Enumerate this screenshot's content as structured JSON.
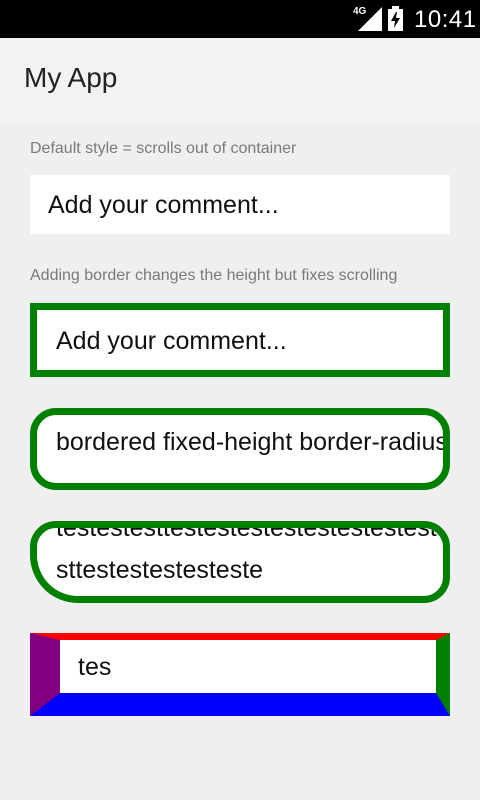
{
  "status_bar": {
    "network": "4G",
    "time": "10:41",
    "signal_icon": "signal-strength-icon",
    "battery_icon": "battery-charging-icon"
  },
  "app_bar": {
    "title": "My App"
  },
  "main": {
    "caption_default": "Default style = scrolls out of container",
    "input_default": "Add your comment...",
    "caption_border": "Adding border changes the height but fixes scrolling",
    "input_bordered": "Add your comment...",
    "input_rounded": "bordered fixed-height border-radius",
    "input_rounded_scrolled_line1": "testestesttestestestestestestestestestestestestestestestes",
    "input_rounded_scrolled_line2": "sttestestestesteste",
    "input_multicolor": "tes"
  },
  "colors": {
    "green_border": "#008000",
    "top_border": "#ff0000",
    "right_border": "#008000",
    "bottom_border": "#0000ff",
    "left_border": "#800080"
  }
}
